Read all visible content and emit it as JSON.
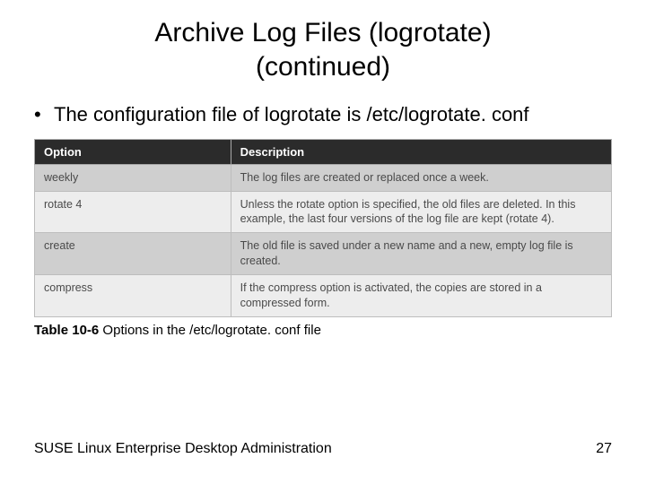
{
  "title_line1": "Archive Log Files (logrotate)",
  "title_line2": "(continued)",
  "bullet_text": "The configuration file of logrotate is /etc/logrotate. conf",
  "table": {
    "headers": {
      "option": "Option",
      "description": "Description"
    },
    "rows": [
      {
        "option": "weekly",
        "description": "The log files are created or replaced once a week."
      },
      {
        "option": "rotate 4",
        "description": "Unless the rotate option is specified, the old files are deleted. In this example, the last four versions of the log file are kept (rotate 4)."
      },
      {
        "option": "create",
        "description": "The old file is saved under a new name and a new, empty log file is created."
      },
      {
        "option": "compress",
        "description": "If the compress option is activated, the copies are stored in a compressed form."
      }
    ]
  },
  "caption_bold": "Table 10-6",
  "caption_rest": " Options in the /etc/logrotate. conf file",
  "footer_left": "SUSE Linux Enterprise Desktop Administration",
  "footer_right": "27"
}
